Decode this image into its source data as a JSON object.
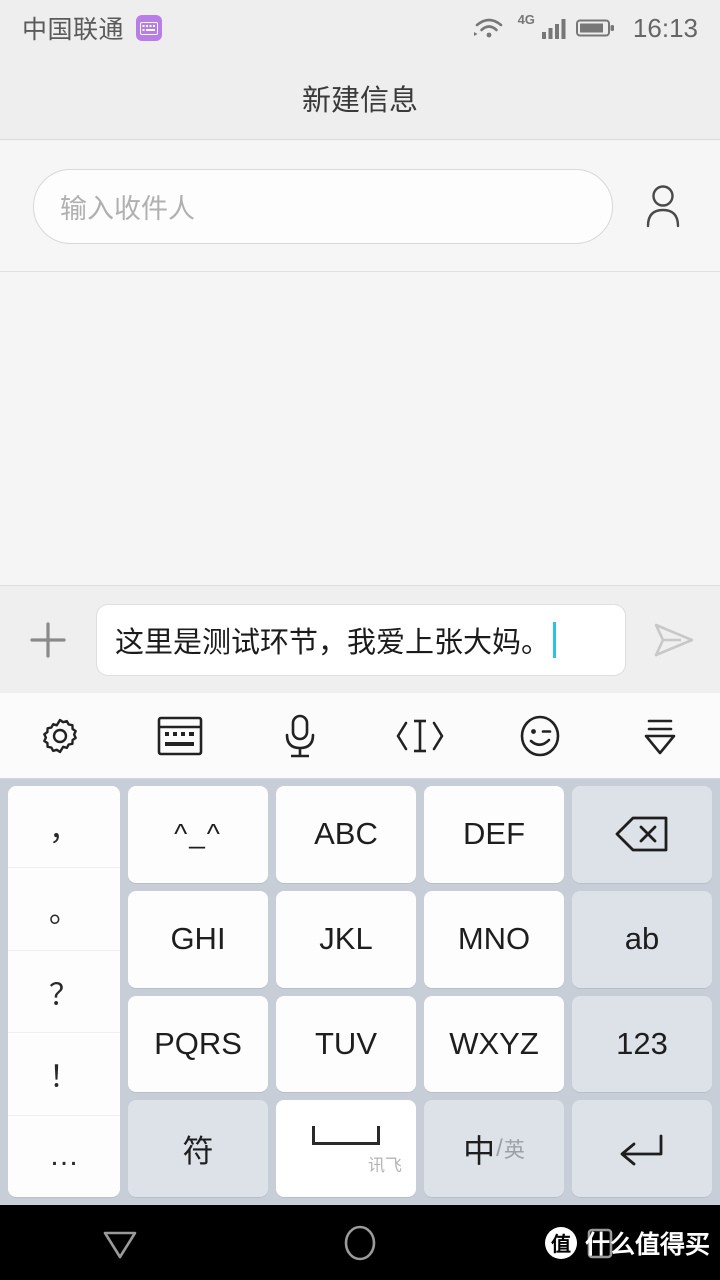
{
  "status_bar": {
    "carrier": "中国联通",
    "keyboard_badge_icon": "keyboard-badge-icon",
    "wifi_icon": "wifi-icon",
    "network_type": "4G",
    "signal_icon": "signal-bars-icon",
    "battery_icon": "battery-icon",
    "time": "16:13"
  },
  "title_bar": {
    "title": "新建信息"
  },
  "recipient": {
    "placeholder": "输入收件人",
    "value": "",
    "contact_icon": "contact-person-icon"
  },
  "compose": {
    "add_icon": "plus-icon",
    "text": "这里是测试环节，我爱上张大妈。",
    "send_icon": "send-paper-plane-icon"
  },
  "ime_toolbar": {
    "items": [
      {
        "name": "settings-icon",
        "label": "设置"
      },
      {
        "name": "keyboard-layout-icon",
        "label": "键盘"
      },
      {
        "name": "microphone-icon",
        "label": "语音"
      },
      {
        "name": "cursor-move-icon",
        "label": "移动光标"
      },
      {
        "name": "emoji-icon",
        "label": "表情"
      },
      {
        "name": "collapse-keyboard-icon",
        "label": "收起"
      }
    ]
  },
  "keyboard": {
    "punctuation_keys": [
      "，",
      "。",
      "？",
      "！",
      "…"
    ],
    "keys": [
      {
        "label": "^_^",
        "name": "key-kaomoji",
        "style": "kaomoji"
      },
      {
        "label": "ABC",
        "name": "key-abc",
        "style": "normal"
      },
      {
        "label": "DEF",
        "name": "key-def",
        "style": "normal"
      },
      {
        "label": "",
        "name": "key-backspace",
        "style": "fn",
        "icon": "backspace-icon"
      },
      {
        "label": "GHI",
        "name": "key-ghi",
        "style": "normal"
      },
      {
        "label": "JKL",
        "name": "key-jkl",
        "style": "normal"
      },
      {
        "label": "MNO",
        "name": "key-mno",
        "style": "normal"
      },
      {
        "label": "ab",
        "name": "key-latin-mode",
        "style": "fn"
      },
      {
        "label": "PQRS",
        "name": "key-pqrs",
        "style": "normal"
      },
      {
        "label": "TUV",
        "name": "key-tuv",
        "style": "normal"
      },
      {
        "label": "WXYZ",
        "name": "key-wxyz",
        "style": "normal"
      },
      {
        "label": "123",
        "name": "key-number-mode",
        "style": "fn"
      },
      {
        "label": "符",
        "name": "key-symbols",
        "style": "fn"
      },
      {
        "label": "",
        "name": "key-space",
        "style": "space",
        "brand": "讯飞"
      },
      {
        "label": "",
        "name": "key-language-toggle",
        "style": "lang",
        "lang_main": "中",
        "lang_sep": "/",
        "lang_sub": "英"
      },
      {
        "label": "",
        "name": "key-enter",
        "style": "fn",
        "icon": "enter-arrow-icon"
      }
    ]
  },
  "nav_bar": {
    "back_icon": "back-triangle-icon",
    "home_icon": "home-circle-icon",
    "recents_icon": "recents-square-icon",
    "watermark_logo": "值",
    "watermark_text": "什么值得买"
  },
  "colors": {
    "keyboard_background": "#c7ced8",
    "key_white": "#fdfdfd",
    "key_function": "#dde2e9",
    "caret": "#28c3e8",
    "badge_purple": "#b97de8",
    "nav_background": "#000000"
  }
}
